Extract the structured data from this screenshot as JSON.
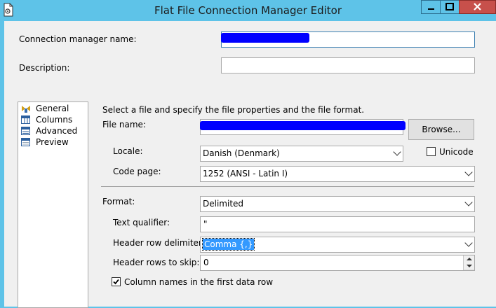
{
  "window": {
    "title": "Flat File Connection Manager Editor",
    "app_icon": "document-gear-icon",
    "controls": {
      "minimize": "minimize-icon",
      "maximize": "maximize-icon",
      "close": "close-icon"
    }
  },
  "fields": {
    "connection_manager_name_label": "Connection manager name:",
    "connection_manager_name_value": "",
    "description_label": "Description:",
    "description_value": ""
  },
  "nav": {
    "items": [
      {
        "label": "General",
        "icon": "general-icon",
        "selected": true
      },
      {
        "label": "Columns",
        "icon": "columns-icon"
      },
      {
        "label": "Advanced",
        "icon": "advanced-icon"
      },
      {
        "label": "Preview",
        "icon": "preview-icon"
      }
    ]
  },
  "general": {
    "instruction": "Select a file and specify the file properties and the file format.",
    "file_name_label": "File name:",
    "file_name_value": "",
    "browse_label": "Browse...",
    "locale_label": "Locale:",
    "locale_value": "Danish (Denmark)",
    "unicode_label": "Unicode",
    "unicode_checked": false,
    "code_page_label": "Code page:",
    "code_page_value": "1252  (ANSI - Latin I)",
    "format_label": "Format:",
    "format_value": "Delimited",
    "text_qualifier_label": "Text qualifier:",
    "text_qualifier_value": "\"",
    "header_row_delimiter_label": "Header row delimiter:",
    "header_row_delimiter_value": "Comma {,}",
    "header_rows_to_skip_label": "Header rows to skip:",
    "header_rows_to_skip_value": "0",
    "column_names_label": "Column names in the first data row",
    "column_names_checked": true
  },
  "colors": {
    "title_bar": "#5ec3e8",
    "close_button": "#c7504b",
    "redaction": "#0000ff",
    "selection": "#3399ff"
  }
}
